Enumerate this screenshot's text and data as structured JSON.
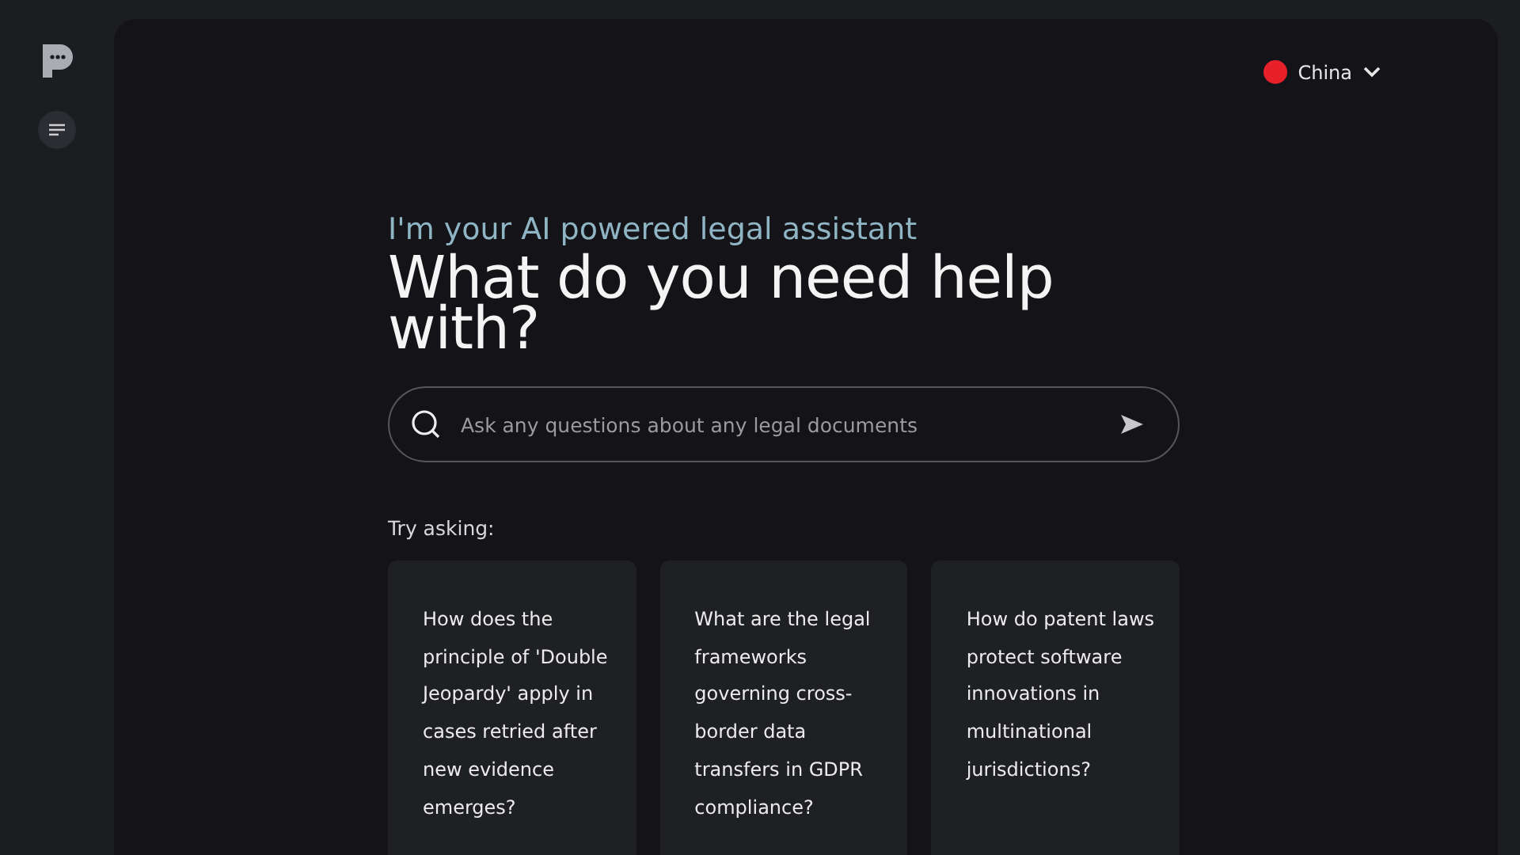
{
  "country_selector": {
    "label": "China",
    "color": "#e8202a"
  },
  "hero": {
    "subtitle": "I'm your AI powered legal assistant",
    "title": "What do you need help with?"
  },
  "search": {
    "placeholder": "Ask any questions about any legal documents"
  },
  "suggestions": {
    "label": "Try asking:",
    "cards": [
      {
        "text": "How does the principle of 'Double Jeopardy' apply in cases retried after new evidence emerges?"
      },
      {
        "text": "What are the legal frameworks governing cross-border data transfers in GDPR compliance?"
      },
      {
        "text": "How do patent laws protect software innovations in multinational jurisdictions?"
      }
    ]
  }
}
